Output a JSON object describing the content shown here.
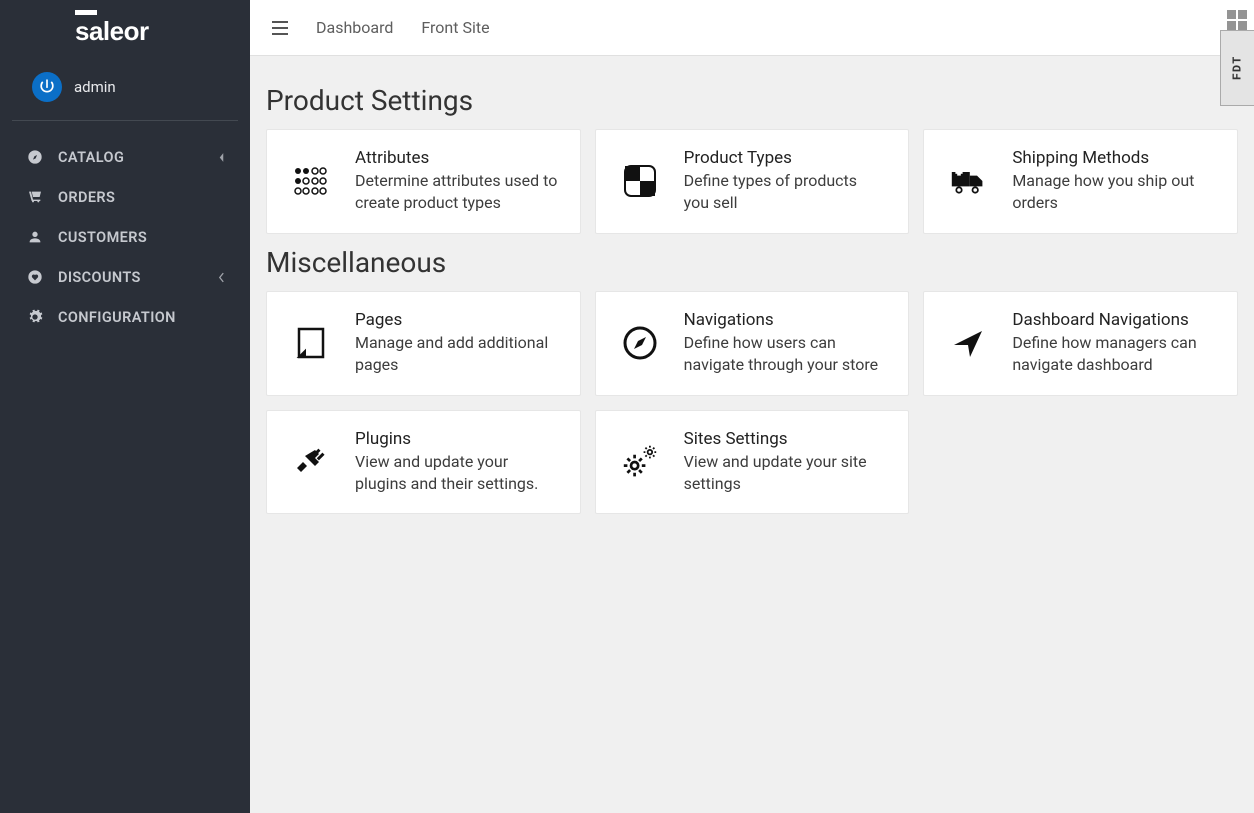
{
  "brand": "saleor",
  "user": {
    "name": "admin"
  },
  "topbar": {
    "links": [
      "Dashboard",
      "Front Site"
    ],
    "debug_label": "FDT"
  },
  "nav": {
    "items": [
      {
        "label": "CATALOG",
        "has_children": true
      },
      {
        "label": "ORDERS",
        "has_children": false
      },
      {
        "label": "CUSTOMERS",
        "has_children": false
      },
      {
        "label": "DISCOUNTS",
        "has_children": true
      },
      {
        "label": "CONFIGURATION",
        "has_children": false
      }
    ]
  },
  "sections": [
    {
      "title": "Product Settings",
      "cards": [
        {
          "title": "Attributes",
          "desc": "Determine attributes used to create product types",
          "icon": "braille"
        },
        {
          "title": "Product Types",
          "desc": "Define types of products you sell",
          "icon": "checker"
        },
        {
          "title": "Shipping Methods",
          "desc": "Manage how you ship out orders",
          "icon": "truck"
        }
      ]
    },
    {
      "title": "Miscellaneous",
      "cards": [
        {
          "title": "Pages",
          "desc": "Manage and add additional pages",
          "icon": "page"
        },
        {
          "title": "Navigations",
          "desc": "Define how users can navigate through your store",
          "icon": "compass"
        },
        {
          "title": "Dashboard Navigations",
          "desc": "Define how managers can navigate dashboard",
          "icon": "location"
        },
        {
          "title": "Plugins",
          "desc": "View and update your plugins and their settings.",
          "icon": "plug"
        },
        {
          "title": "Sites Settings",
          "desc": "View and update your site settings",
          "icon": "gears"
        }
      ]
    }
  ]
}
